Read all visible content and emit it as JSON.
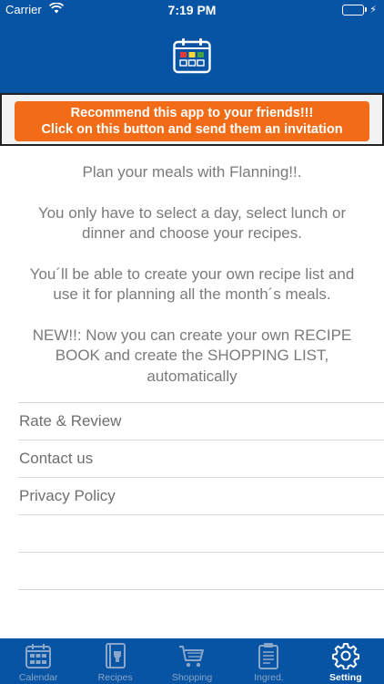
{
  "status_bar": {
    "carrier": "Carrier",
    "time": "7:19 PM",
    "battery_level": 1.0
  },
  "header": {
    "logo_icon": "calendar-grid-icon"
  },
  "promo": {
    "line1": "Recommend this app to your friends!!!",
    "line2": "Click on this button and send  them an invitation",
    "color": "#f26c17"
  },
  "intro": {
    "p1": "Plan your meals with Flanning!!.",
    "p2": "You only have to select a day, select lunch or dinner and choose your recipes.",
    "p3": "You´ll be able to create your own recipe list and use it for planning all the month´s meals.",
    "p4": "NEW!!: Now you can create your own RECIPE BOOK and create the SHOPPING LIST, automatically"
  },
  "menu": {
    "items": [
      {
        "label": "Rate & Review"
      },
      {
        "label": "Contact us"
      },
      {
        "label": "Privacy Policy"
      }
    ]
  },
  "tabs": [
    {
      "label": "Calendar",
      "icon": "calendar-icon"
    },
    {
      "label": "Recipes",
      "icon": "recipe-book-icon"
    },
    {
      "label": "Shopping",
      "icon": "shopping-cart-icon"
    },
    {
      "label": "Ingred.",
      "icon": "clipboard-icon"
    },
    {
      "label": "Setting",
      "icon": "gear-icon",
      "active": true
    }
  ],
  "colors": {
    "brand_blue": "#0753a4",
    "tab_inactive": "#8aa6c8",
    "text_gray": "#7a7a7a"
  }
}
